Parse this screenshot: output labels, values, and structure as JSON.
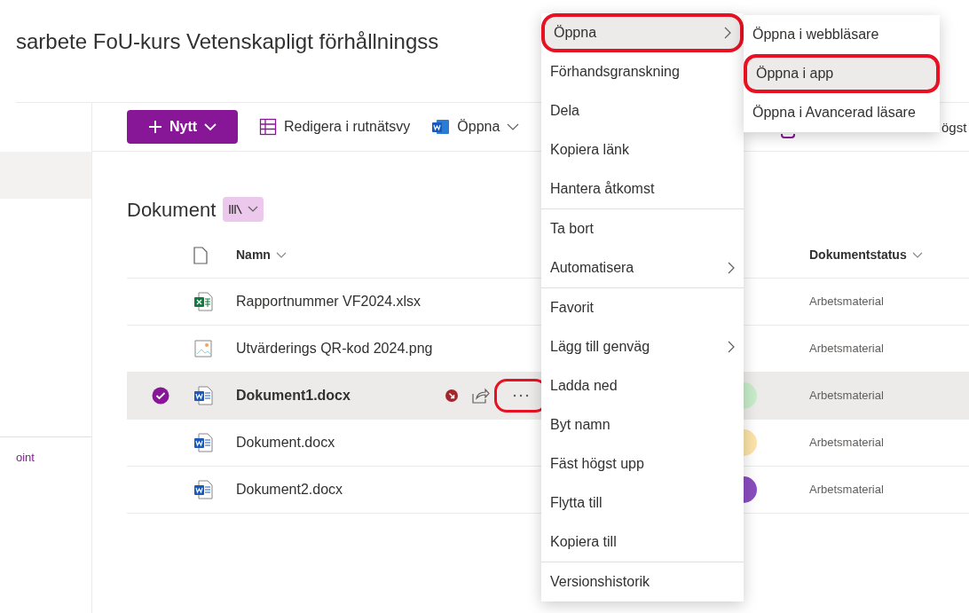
{
  "page_title": "sarbete FoU-kurs Vetenskapligt förhållningss",
  "sidebar": {
    "items": [
      {
        "selected": true
      }
    ],
    "link": "oint"
  },
  "toolbar": {
    "new_button": "Nytt",
    "items": [
      {
        "kind": "grid",
        "label": "Redigera i rutnätsvy"
      },
      {
        "kind": "word",
        "label": "Öppna"
      }
    ],
    "hidden_label": "ögst"
  },
  "library": {
    "title": "Dokument"
  },
  "table": {
    "columns": [
      "Namn",
      "Dokumentstatus"
    ],
    "rows": [
      {
        "name": "Rapportnummer VF2024.xlsx",
        "kind": "excel",
        "status": "Arbetsmaterial",
        "selected": false
      },
      {
        "name": "Utvärderings QR-kod 2024.png",
        "kind": "image",
        "status": "Arbetsmaterial",
        "selected": false
      },
      {
        "name": "Dokument1.docx",
        "kind": "word",
        "status": "Arbetsmaterial",
        "selected": true,
        "color": "#c7ecc9",
        "checked_out": true,
        "more_highlighted": true
      },
      {
        "name": "Dokument.docx",
        "kind": "word",
        "status": "Arbetsmaterial",
        "selected": false,
        "color": "#fbe3a8"
      },
      {
        "name": "Dokument2.docx",
        "kind": "word",
        "status": "Arbetsmaterial",
        "selected": false,
        "color": "#8a4dc0"
      }
    ]
  },
  "context_menu": {
    "sections": [
      [
        {
          "label": "Öppna",
          "submenu": true,
          "hovered": true,
          "highlighted": true
        },
        {
          "label": "Förhandsgranskning",
          "submenu": false,
          "hovered": false,
          "highlighted": false
        },
        {
          "label": "Dela",
          "submenu": false,
          "hovered": false,
          "highlighted": false
        },
        {
          "label": "Kopiera länk",
          "submenu": false,
          "hovered": false,
          "highlighted": false
        },
        {
          "label": "Hantera åtkomst",
          "submenu": false,
          "hovered": false,
          "highlighted": false
        }
      ],
      [
        {
          "label": "Ta bort",
          "submenu": false,
          "hovered": false,
          "highlighted": false
        },
        {
          "label": "Automatisera",
          "submenu": true,
          "hovered": false,
          "highlighted": false
        }
      ],
      [
        {
          "label": "Favorit",
          "submenu": false,
          "hovered": false,
          "highlighted": false
        },
        {
          "label": "Lägg till genväg",
          "submenu": true,
          "hovered": false,
          "highlighted": false
        },
        {
          "label": "Ladda ned",
          "submenu": false,
          "hovered": false,
          "highlighted": false
        },
        {
          "label": "Byt namn",
          "submenu": false,
          "hovered": false,
          "highlighted": false
        },
        {
          "label": "Fäst högst upp",
          "submenu": false,
          "hovered": false,
          "highlighted": false
        },
        {
          "label": "Flytta till",
          "submenu": false,
          "hovered": false,
          "highlighted": false
        },
        {
          "label": "Kopiera till",
          "submenu": false,
          "hovered": false,
          "highlighted": false
        }
      ],
      [
        {
          "label": "Versionshistorik",
          "submenu": false,
          "hovered": false,
          "highlighted": false
        }
      ]
    ]
  },
  "submenu": {
    "items": [
      {
        "label": "Öppna i webbläsare",
        "hovered": false,
        "highlighted": false
      },
      {
        "label": "Öppna i app",
        "hovered": true,
        "highlighted": true
      },
      {
        "label": "Öppna i Avancerad läsare",
        "hovered": false,
        "highlighted": false
      }
    ]
  }
}
